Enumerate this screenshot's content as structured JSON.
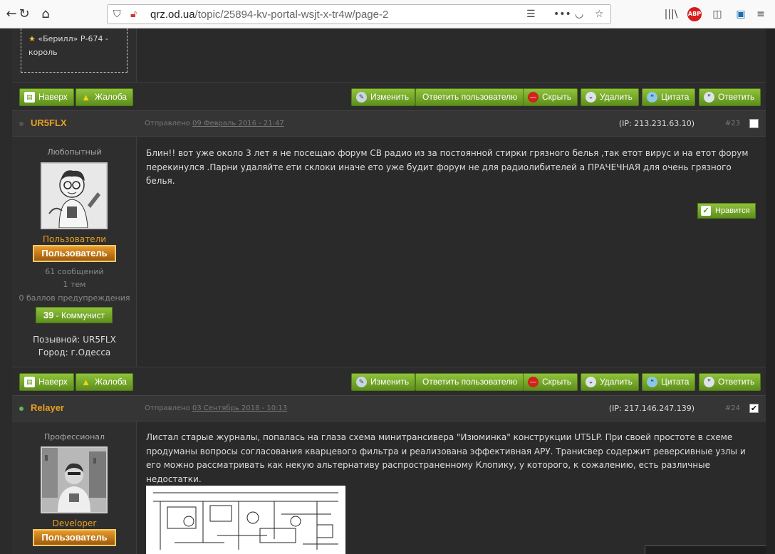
{
  "browser": {
    "url_domain": "qrz.od.ua",
    "url_path": "/topic/25894-kv-portal-wsjt-x-tr4w/page-2",
    "abp_label": "ABP"
  },
  "prev_post": {
    "award_line1": "«Берилл» Р-674 -",
    "award_line2": "король"
  },
  "toolbar": {
    "top": "Наверх",
    "report": "Жалоба",
    "edit": "Изменить",
    "reply_user": "Ответить пользователю",
    "hide": "Скрыть",
    "delete": "Удалить",
    "quote": "Цитата",
    "reply": "Ответить"
  },
  "posts": [
    {
      "username": "UR5FLX",
      "sent_label": "Отправлено",
      "sent_date": "09 Февраль 2016 - 21:47",
      "ip": "(IP: 213.231.63.10)",
      "num": "#23",
      "checked": false,
      "rank": "Любопытный",
      "group": "Пользователи",
      "badge": "Пользователь",
      "posts_count": "61 сообщений",
      "topics": "1 тем",
      "warnings": "0 баллов предупреждения",
      "rep_num": "39",
      "rep_label": " - Коммунист",
      "callsign": "Позывной: UR5FLX",
      "city": "Город: г.Одесса",
      "text": "Блин!! вот  уже около 3 лет я не посещаю форум СВ радио из за постоянной стирки грязного белья ,так етот вирус и на етот форум  перекинулся .Парни удаляйте ети склоки иначе ето уже будит форум не для радиолибителей а ПРАЧЕЧНАЯ для очень грязного белья.",
      "like": "Нравится"
    },
    {
      "username": "Relayer",
      "sent_label": "Отправлено",
      "sent_date": "03 Сентябрь 2018 - 10:13",
      "ip": "(IP: 217.146.247.139)",
      "num": "#24",
      "checked": true,
      "rank": "Профессионал",
      "group": "Developer",
      "badge": "Пользователь",
      "text": "Листал старые журналы, попалась на глаза схема минитрансивера \"Изюминка\" конструкции UT5LP. При своей простоте в схеме продуманы вопросы согласования кварцевого фильтра и реализована эффективная АРУ. Транисвер содержит реверсивные узлы и его можно рассматривать как некую альтернативу распространенному Клопику, у которого, к сожалению, есть различные недостатки."
    }
  ],
  "colors": {
    "accent_orange": "#e8a020",
    "button_green": "#6fa526",
    "online_dot": "#5cb85c",
    "offline_dot": "#555555"
  }
}
